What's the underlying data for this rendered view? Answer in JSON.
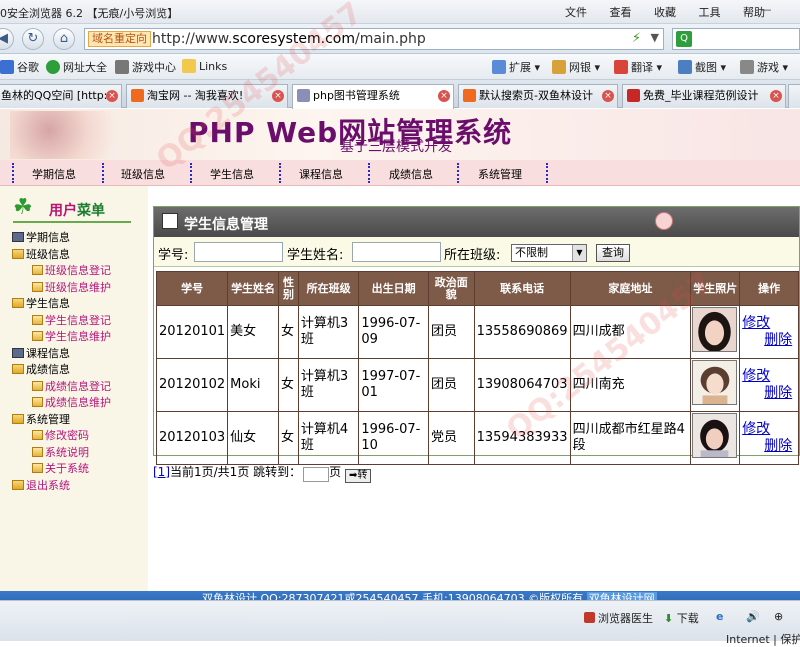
{
  "browser": {
    "title": "0安全浏览器 6.2 【无痕/小号浏览】",
    "menu": [
      "文件",
      "查看",
      "收藏",
      "工具",
      "帮助"
    ],
    "redirect_tag": "域名重定向",
    "url_prefix": "http://www.",
    "url_domain": "scoresystem.com",
    "url_path": "/main.php",
    "bookmarks": [
      "谷歌",
      "网址大全",
      "游戏中心",
      "Links"
    ],
    "tools": [
      "扩展",
      "网银",
      "翻译",
      "截图",
      "游戏"
    ],
    "tabs": [
      {
        "label": "鱼林的QQ空间 [http:",
        "active": false
      },
      {
        "label": "淘宝网 -- 淘我喜欢!",
        "active": false
      },
      {
        "label": "php图书管理系统",
        "active": true
      },
      {
        "label": "默认搜索页-双鱼林设计",
        "active": false
      },
      {
        "label": "免费_毕业课程范例设计",
        "active": false
      }
    ]
  },
  "site": {
    "title": "PHP Web网站管理系统",
    "subtitle": "基于三层模式开发",
    "nav": [
      "学期信息",
      "班级信息",
      "学生信息",
      "课程信息",
      "成绩信息",
      "系统管理"
    ]
  },
  "sidebar": {
    "heading_a": "用户",
    "heading_b": "菜单",
    "items": [
      {
        "label": "学期信息",
        "level": 1
      },
      {
        "label": "班级信息",
        "level": 1
      },
      {
        "label": "班级信息登记",
        "level": 2
      },
      {
        "label": "班级信息维护",
        "level": 2
      },
      {
        "label": "学生信息",
        "level": 1
      },
      {
        "label": "学生信息登记",
        "level": 2
      },
      {
        "label": "学生信息维护",
        "level": 2
      },
      {
        "label": "课程信息",
        "level": 1
      },
      {
        "label": "成绩信息",
        "level": 1
      },
      {
        "label": "成绩信息登记",
        "level": 2
      },
      {
        "label": "成绩信息维护",
        "level": 2
      },
      {
        "label": "系统管理",
        "level": 1
      },
      {
        "label": "修改密码",
        "level": 2
      },
      {
        "label": "系统说明",
        "level": 2
      },
      {
        "label": "关于系统",
        "level": 2
      },
      {
        "label": "退出系统",
        "level": 1
      }
    ]
  },
  "panel": {
    "title": "学生信息管理",
    "search": {
      "student_no_label": "学号:",
      "student_name_label": "学生姓名:",
      "class_label": "所在班级:",
      "class_value": "不限制",
      "query_button": "查询"
    },
    "columns": [
      "学号",
      "学生姓名",
      "性别",
      "所在班级",
      "出生日期",
      "政治面貌",
      "联系电话",
      "家庭地址",
      "学生照片",
      "操作"
    ],
    "rows": [
      {
        "no": "20120101",
        "name": "美女",
        "sex": "女",
        "class": "计算机3班",
        "birth": "1996-07-09",
        "politics": "团员",
        "phone": "13558690869",
        "address": "四川成都"
      },
      {
        "no": "20120102",
        "name": "Moki",
        "sex": "女",
        "class": "计算机3班",
        "birth": "1997-07-01",
        "politics": "团员",
        "phone": "13908064703",
        "address": "四川南充"
      },
      {
        "no": "20120103",
        "name": "仙女",
        "sex": "女",
        "class": "计算机4班",
        "birth": "1996-07-10",
        "politics": "党员",
        "phone": "13594383933",
        "address": "四川成都市红星路4段"
      }
    ],
    "edit_label": "修改",
    "delete_label": "删除",
    "pager": {
      "page_link": "[1]",
      "info": "当前1页/共1页 跳转到：",
      "unit": "页",
      "go": "➡转"
    }
  },
  "footer": {
    "text": "双鱼林设计 QQ:287307421或254540457 手机:13908064703 ©版权所有",
    "link": "双鱼林设计网"
  },
  "statusbar": {
    "items": [
      "浏览器医生",
      "下载"
    ],
    "zone": "Internet | 保护"
  },
  "watermark": "QQ:254540457"
}
